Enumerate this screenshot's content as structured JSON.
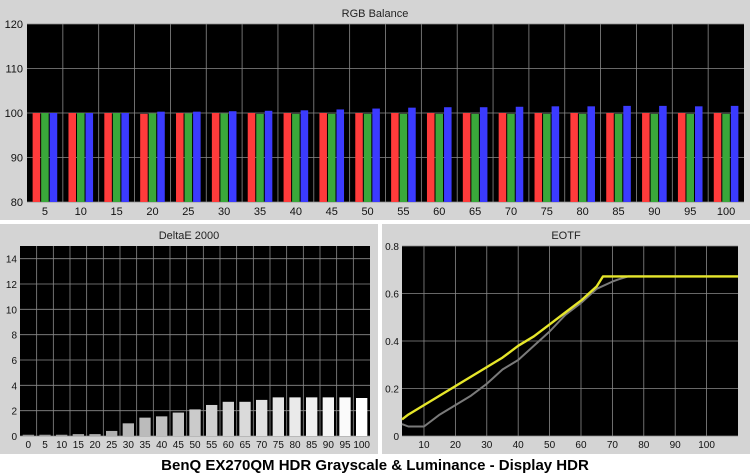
{
  "caption": "BenQ EX270QM HDR Grayscale & Luminance - Display HDR",
  "chart_data": [
    {
      "type": "bar",
      "title": "RGB Balance",
      "categories": [
        "5",
        "10",
        "15",
        "20",
        "25",
        "30",
        "35",
        "40",
        "45",
        "50",
        "55",
        "60",
        "65",
        "70",
        "75",
        "80",
        "85",
        "90",
        "95",
        "100"
      ],
      "ylim": [
        80,
        120
      ],
      "yticks": [
        80,
        90,
        100,
        110,
        120
      ],
      "grid": true,
      "series": [
        {
          "values": [
            100.0,
            100.0,
            100.0,
            99.8,
            100.0,
            100.0,
            100.0,
            100.0,
            100.0,
            100.0,
            100.0,
            100.0,
            100.0,
            100.0,
            100.0,
            100.0,
            100.0,
            100.0,
            100.0,
            100.0
          ],
          "color": "#ff3b3b"
        },
        {
          "values": [
            100.0,
            100.0,
            100.0,
            99.9,
            99.9,
            99.9,
            99.8,
            99.8,
            99.8,
            99.8,
            99.8,
            99.8,
            99.8,
            99.8,
            99.8,
            99.8,
            99.8,
            99.8,
            99.8,
            99.8
          ],
          "color": "#3aa83a"
        },
        {
          "values": [
            100.0,
            100.0,
            100.0,
            100.3,
            100.3,
            100.4,
            100.5,
            100.6,
            100.8,
            101.0,
            101.2,
            101.3,
            101.3,
            101.4,
            101.5,
            101.5,
            101.6,
            101.6,
            101.5,
            101.6
          ],
          "color": "#3b3bff"
        }
      ]
    },
    {
      "type": "bar",
      "title": "DeltaE 2000",
      "categories": [
        "0",
        "5",
        "10",
        "15",
        "20",
        "25",
        "30",
        "35",
        "40",
        "45",
        "50",
        "55",
        "60",
        "65",
        "70",
        "75",
        "80",
        "85",
        "90",
        "95",
        "100"
      ],
      "values": [
        0.1,
        0.1,
        0.1,
        0.15,
        0.15,
        0.4,
        1.0,
        1.45,
        1.55,
        1.85,
        2.1,
        2.45,
        2.7,
        2.7,
        2.85,
        3.05,
        3.05,
        3.05,
        3.05,
        3.05,
        3.0
      ],
      "ylim": [
        0,
        15
      ],
      "yticks": [
        0,
        2,
        4,
        6,
        8,
        10,
        12,
        14
      ],
      "grid": true
    },
    {
      "type": "line",
      "title": "EOTF",
      "xlim": [
        3,
        110
      ],
      "ylim": [
        0,
        0.8
      ],
      "xticks": [
        10,
        20,
        30,
        40,
        50,
        60,
        70,
        80,
        90,
        100
      ],
      "yticks": [
        0,
        0.2,
        0.4,
        0.6,
        0.8
      ],
      "grid": true,
      "series": [
        {
          "x": [
            3,
            5,
            10,
            15,
            20,
            25,
            30,
            35,
            40,
            45,
            50,
            55,
            60,
            65,
            70,
            72,
            75,
            80,
            85,
            90,
            95,
            100,
            110
          ],
          "values": [
            0.05,
            0.04,
            0.04,
            0.09,
            0.13,
            0.17,
            0.22,
            0.28,
            0.32,
            0.38,
            0.44,
            0.51,
            0.56,
            0.62,
            0.65,
            0.66,
            0.672,
            0.672,
            0.672,
            0.672,
            0.672,
            0.672,
            0.672
          ],
          "color": "#7a7a7a"
        },
        {
          "x": [
            3,
            5,
            10,
            15,
            20,
            25,
            30,
            35,
            40,
            45,
            50,
            55,
            60,
            65,
            67,
            70,
            75,
            80,
            85,
            90,
            95,
            100,
            110
          ],
          "values": [
            0.07,
            0.09,
            0.13,
            0.17,
            0.21,
            0.25,
            0.29,
            0.33,
            0.38,
            0.42,
            0.47,
            0.52,
            0.57,
            0.63,
            0.672,
            0.672,
            0.672,
            0.672,
            0.672,
            0.672,
            0.672,
            0.672,
            0.672
          ],
          "color": "#e6e62a"
        }
      ]
    }
  ]
}
